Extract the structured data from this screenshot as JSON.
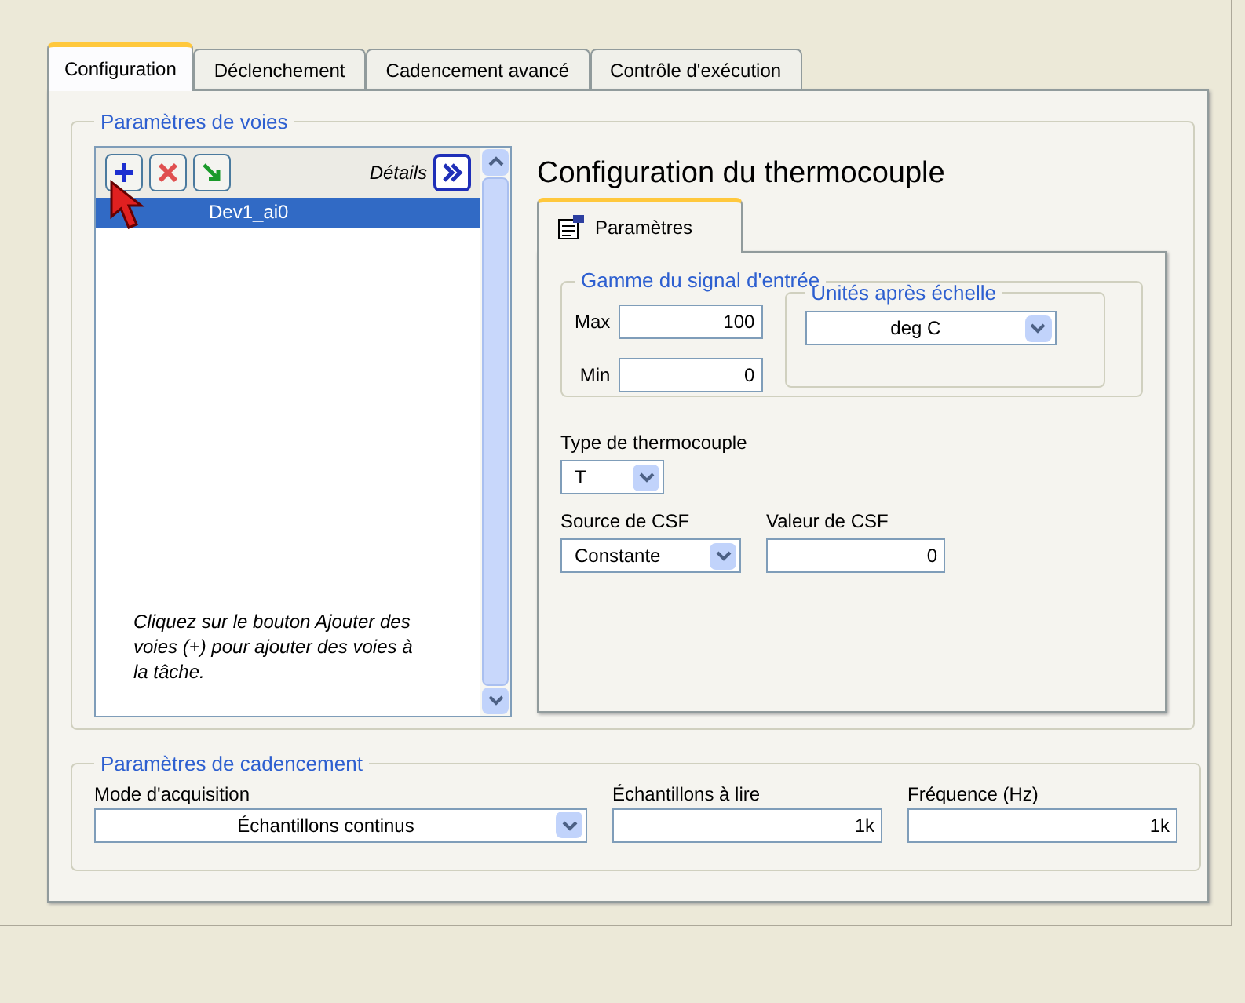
{
  "tabs": [
    {
      "label": "Configuration",
      "selected": true
    },
    {
      "label": "Déclenchement",
      "selected": false
    },
    {
      "label": "Cadencement avancé",
      "selected": false
    },
    {
      "label": "Contrôle d'exécution",
      "selected": false
    }
  ],
  "channels_group": {
    "legend": "Paramètres de voies",
    "details_label": "Détails",
    "channels": [
      {
        "name": "Dev1_ai0",
        "selected": true
      }
    ],
    "hint": "Cliquez sur le bouton Ajouter des voies (+) pour ajouter des voies à la tâche."
  },
  "config": {
    "title": "Configuration du thermocouple",
    "tabs": [
      {
        "label": "Paramètres",
        "selected": true
      }
    ],
    "range": {
      "legend": "Gamme du signal d'entrée",
      "max_label": "Max",
      "max": "100",
      "min_label": "Min",
      "min": "0"
    },
    "units": {
      "legend": "Unités après échelle",
      "value": "deg C"
    },
    "type": {
      "label": "Type de thermocouple",
      "value": "T"
    },
    "cjc_source": {
      "label": "Source de CSF",
      "value": "Constante"
    },
    "cjc_value": {
      "label": "Valeur de CSF",
      "value": "0"
    }
  },
  "timing": {
    "legend": "Paramètres de cadencement",
    "mode": {
      "label": "Mode d'acquisition",
      "value": "Échantillons continus"
    },
    "samples": {
      "label": "Échantillons à lire",
      "value": "1k"
    },
    "rate": {
      "label": "Fréquence (Hz)",
      "value": "1k"
    }
  }
}
